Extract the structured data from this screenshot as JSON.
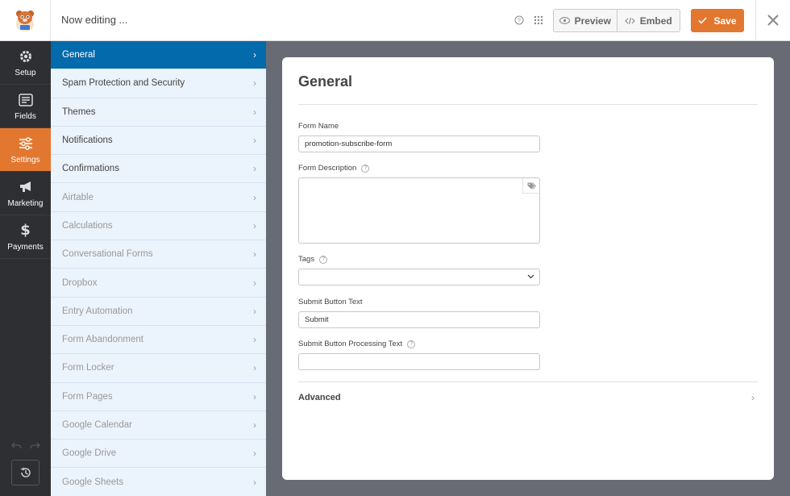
{
  "topbar": {
    "editing_label": "Now editing ...",
    "preview_label": "Preview",
    "embed_label": "Embed",
    "save_label": "Save"
  },
  "leftnav": {
    "items": [
      {
        "label": "Setup",
        "icon": "gear-icon"
      },
      {
        "label": "Fields",
        "icon": "fields-icon"
      },
      {
        "label": "Settings",
        "icon": "sliders-icon",
        "active": true
      },
      {
        "label": "Marketing",
        "icon": "megaphone-icon"
      },
      {
        "label": "Payments",
        "icon": "dollar-icon"
      }
    ]
  },
  "settings_panel": {
    "items": [
      {
        "label": "General",
        "state": "active"
      },
      {
        "label": "Spam Protection and Security",
        "state": "enabled"
      },
      {
        "label": "Themes",
        "state": "enabled"
      },
      {
        "label": "Notifications",
        "state": "enabled"
      },
      {
        "label": "Confirmations",
        "state": "enabled"
      },
      {
        "label": "Airtable",
        "state": "disabled"
      },
      {
        "label": "Calculations",
        "state": "disabled"
      },
      {
        "label": "Conversational Forms",
        "state": "disabled"
      },
      {
        "label": "Dropbox",
        "state": "disabled"
      },
      {
        "label": "Entry Automation",
        "state": "disabled"
      },
      {
        "label": "Form Abandonment",
        "state": "disabled"
      },
      {
        "label": "Form Locker",
        "state": "disabled"
      },
      {
        "label": "Form Pages",
        "state": "disabled"
      },
      {
        "label": "Google Calendar",
        "state": "disabled"
      },
      {
        "label": "Google Drive",
        "state": "disabled"
      },
      {
        "label": "Google Sheets",
        "state": "disabled"
      }
    ]
  },
  "main": {
    "title": "General",
    "form_name_label": "Form Name",
    "form_name_value": "promotion-subscribe-form",
    "form_description_label": "Form Description",
    "form_description_value": "",
    "tags_label": "Tags",
    "submit_text_label": "Submit Button Text",
    "submit_text_value": "Submit",
    "processing_text_label": "Submit Button Processing Text",
    "processing_text_value": "",
    "advanced_label": "Advanced"
  },
  "colors": {
    "accent_orange": "#e27730",
    "active_blue": "#036aab",
    "panel_bg": "#ebf3fc",
    "nav_bg": "#2d2f32"
  }
}
